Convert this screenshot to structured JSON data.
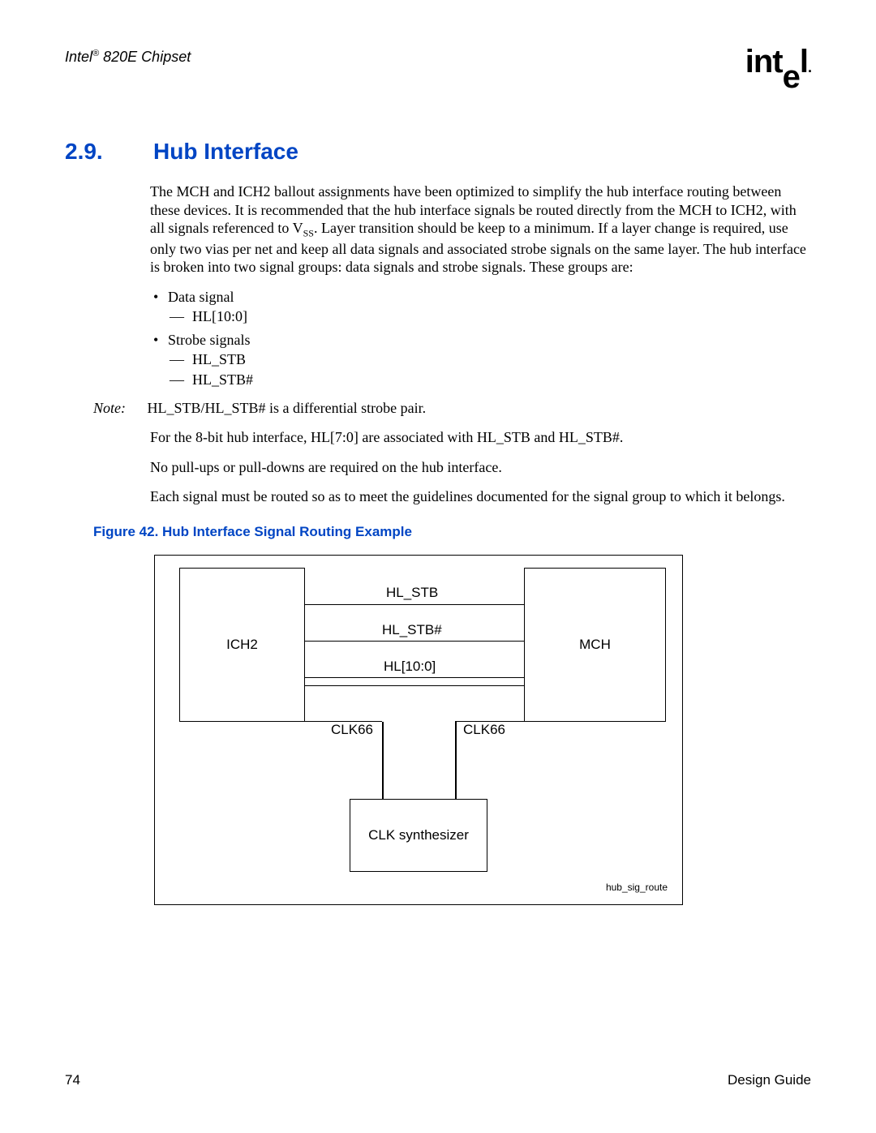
{
  "header": {
    "doc_title_prefix": "Intel",
    "doc_title_suffix": " 820E Chipset",
    "logo_text": "intel",
    "logo_dot": "."
  },
  "section": {
    "number": "2.9.",
    "title": "Hub Interface"
  },
  "paragraphs": {
    "intro_a": "The MCH and ICH2 ballout assignments have been optimized to simplify the hub interface routing between these devices. It is recommended that the hub interface signals be routed directly from the MCH to ICH2, with all signals referenced to V",
    "intro_sub": "SS",
    "intro_b": ". Layer transition should be keep to a minimum. If a layer change is required, use only two vias per net and keep all data signals and associated strobe signals on the same layer. The hub interface is broken into two signal groups: data signals and strobe signals. These groups are:",
    "note_label": "Note:",
    "note_text": "HL_STB/HL_STB# is a differential strobe pair.",
    "assoc": "For the 8-bit hub interface, HL[7:0] are associated with HL_STB and HL_STB#.",
    "pulls": "No pull-ups or pull-downs are required on the hub interface.",
    "guide": "Each signal must be routed so as to meet the guidelines documented for the signal group to which it belongs."
  },
  "bullets": {
    "data_signal": "Data signal",
    "data_sub": "HL[10:0]",
    "strobe": "Strobe signals",
    "strobe_sub1": "HL_STB",
    "strobe_sub2": "HL_STB#"
  },
  "figure": {
    "caption": "Figure 42. Hub Interface Signal Routing Example",
    "ich2": "ICH2",
    "mch": "MCH",
    "hl_stb": "HL_STB",
    "hl_stbn": "HL_STB#",
    "hl_bus": "HL[10:0]",
    "clk66_l": "CLK66",
    "clk66_r": "CLK66",
    "clk_synth": "CLK synthesizer",
    "ref": "hub_sig_route"
  },
  "footer": {
    "page": "74",
    "guide": "Design Guide"
  }
}
